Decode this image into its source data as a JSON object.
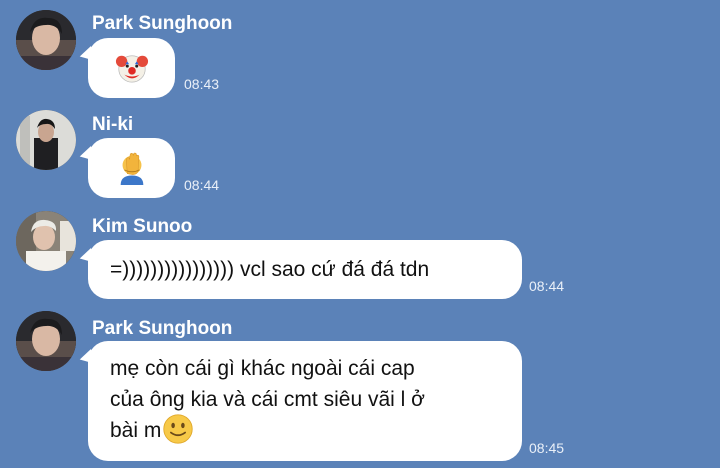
{
  "messages": [
    {
      "sender": "Park Sunghoon",
      "avatar": "sunghoon-avatar",
      "content_type": "emoji",
      "emoji": "clown-face-icon",
      "time": "08:43"
    },
    {
      "sender": "Ni-ki",
      "avatar": "niki-avatar",
      "content_type": "emoji",
      "emoji": "face-palm-icon",
      "time": "08:44"
    },
    {
      "sender": "Kim Sunoo",
      "avatar": "sunoo-avatar",
      "content_type": "text",
      "text": "=)))))))))))))))) vcl sao cứ đá đá tdn",
      "time": "08:44"
    },
    {
      "sender": "Park Sunghoon",
      "avatar": "sunghoon-avatar",
      "content_type": "text",
      "text_lines": [
        "mẹ còn cái gì khác ngoài cái cap",
        "của ông kia và cái cmt siêu vãi l ở",
        "bài m"
      ],
      "trailing_emoji": "slightly-smiling-face-icon",
      "time": "08:45"
    }
  ],
  "colors": {
    "background": "#5b82b8",
    "bubble": "#ffffff",
    "sender_name": "#ffffff",
    "timestamp": "#eaf0f8"
  }
}
